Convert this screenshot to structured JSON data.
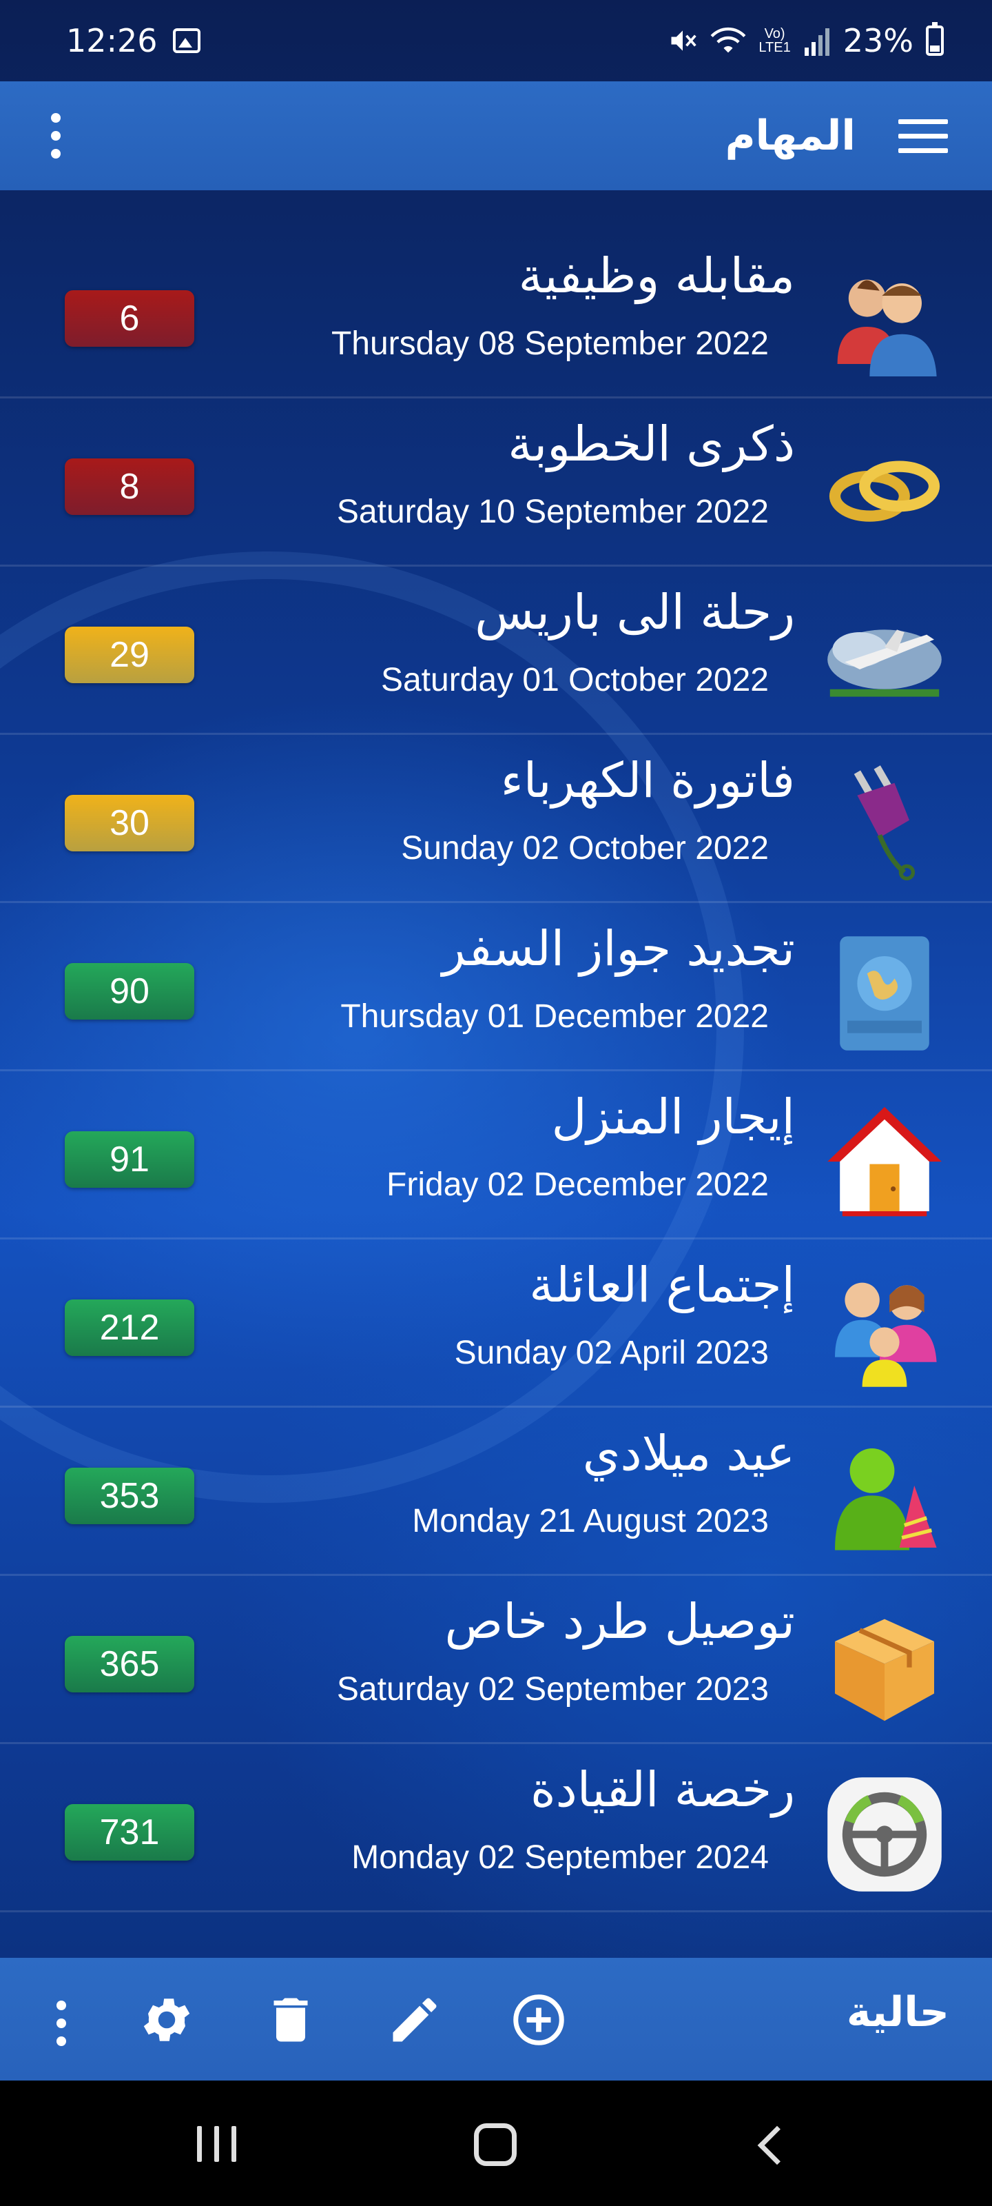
{
  "status_bar": {
    "time": "12:26",
    "battery": "23%",
    "icons": [
      "image-icon",
      "mute-icon",
      "wifi-icon",
      "volte-icon",
      "signal-icon",
      "battery-icon"
    ]
  },
  "app_bar": {
    "title": "المهام",
    "menu_icon": "hamburger-icon",
    "overflow_icon": "more-vert-icon"
  },
  "tasks": [
    {
      "name": "مقابله وظيفية",
      "date": "Thursday 08 September 2022",
      "days": "6",
      "color": "red",
      "icon": "people-icon"
    },
    {
      "name": "ذكرى الخطوبة",
      "date": "Saturday 10 September 2022",
      "days": "8",
      "color": "red",
      "icon": "rings-icon"
    },
    {
      "name": "رحلة الى باريس",
      "date": "Saturday 01 October 2022",
      "days": "29",
      "color": "yellow",
      "icon": "airplane-icon"
    },
    {
      "name": "فاتورة الكهرباء",
      "date": "Sunday 02 October 2022",
      "days": "30",
      "color": "yellow",
      "icon": "plug-icon"
    },
    {
      "name": "تجديد جواز السفر",
      "date": "Thursday 01 December 2022",
      "days": "90",
      "color": "green",
      "icon": "passport-icon"
    },
    {
      "name": "إيجار المنزل",
      "date": "Friday 02 December 2022",
      "days": "91",
      "color": "green",
      "icon": "house-icon"
    },
    {
      "name": "إجتماع العائلة",
      "date": "Sunday 02 April 2023",
      "days": "212",
      "color": "green",
      "icon": "family-icon"
    },
    {
      "name": "عيد ميلادي",
      "date": "Monday 21 August 2023",
      "days": "353",
      "color": "green",
      "icon": "birthday-icon"
    },
    {
      "name": "توصيل طرد خاص",
      "date": "Saturday 02 September 2023",
      "days": "365",
      "color": "green",
      "icon": "package-icon"
    },
    {
      "name": "رخصة القيادة",
      "date": "Monday 02 September 2024",
      "days": "731",
      "color": "green",
      "icon": "steering-wheel-icon"
    }
  ],
  "toolbar": {
    "label": "حالية",
    "buttons": [
      "more-vert-icon",
      "settings-icon",
      "delete-icon",
      "edit-icon",
      "add-circle-icon"
    ]
  },
  "colors": {
    "red": "#8e1b24",
    "yellow": "#e0ad22",
    "green": "#1f9350",
    "app_bar": "#2a65be"
  }
}
